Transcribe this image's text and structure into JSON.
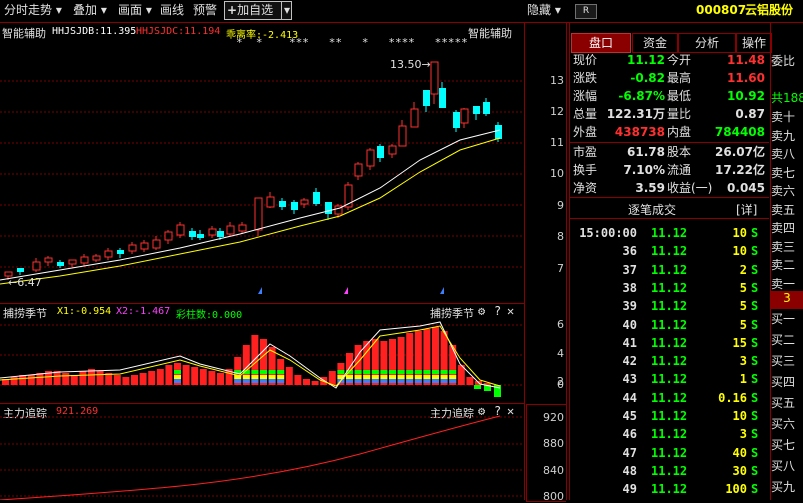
{
  "toolbar": {
    "items": [
      "分时走势",
      "叠加",
      "画面",
      "画线",
      "预警"
    ],
    "add_watch": "加自选",
    "hide": "隐藏",
    "corner_icon": "R"
  },
  "stock": {
    "code": "000807",
    "name": "云铝股份"
  },
  "main_chart": {
    "indicator_name": "智能辅助",
    "indicator_name_right": "智能辅助",
    "line1": "HHJSJDB:11.395",
    "line2": "HHJSJDC:11.194",
    "deviation": "乖离率:-2.413",
    "stars": "*  *    ***   **   *   ****   *****",
    "high_label": "13.50",
    "low_label": "6.47",
    "y_ticks": [
      "13",
      "12",
      "11",
      "10",
      "9",
      "8",
      "7"
    ]
  },
  "sub1": {
    "name": "捕捞季节",
    "x1": "X1:-0.954",
    "x2": "X2:-1.467",
    "bars": "彩柱数:0.000",
    "y_ticks": [
      "6",
      "4",
      "2",
      "0"
    ]
  },
  "sub2": {
    "name": "主力追踪",
    "value": "921.269",
    "y_ticks": [
      "920",
      "880",
      "840",
      "800"
    ]
  },
  "tabs": [
    "盘口",
    "资金",
    "分析",
    "操作"
  ],
  "quote": {
    "rows": [
      {
        "l1": "现价",
        "v1": "11.12",
        "l2": "今开",
        "v2": "11.48",
        "c1": "#00ff00",
        "c2": "#ff3030"
      },
      {
        "l1": "涨跌",
        "v1": "-0.82",
        "l2": "最高",
        "v2": "11.60",
        "c1": "#00ff00",
        "c2": "#ff3030"
      },
      {
        "l1": "涨幅",
        "v1": "-6.87%",
        "l2": "最低",
        "v2": "10.92",
        "c1": "#00ff00",
        "c2": "#00ff00"
      },
      {
        "l1": "总量",
        "v1": "122.31万",
        "l2": "量比",
        "v2": "0.87",
        "c1": "#e0e0e0",
        "c2": "#e0e0e0"
      },
      {
        "l1": "外盘",
        "v1": "438738",
        "l2": "内盘",
        "v2": "784408",
        "c1": "#ff3030",
        "c2": "#00ff00"
      },
      {
        "l1": "市盈",
        "v1": "61.78",
        "l2": "股本",
        "v2": "26.07亿",
        "c1": "#e0e0e0",
        "c2": "#e0e0e0"
      },
      {
        "l1": "换手",
        "v1": "7.10%",
        "l2": "流通",
        "v2": "17.22亿",
        "c1": "#e0e0e0",
        "c2": "#e0e0e0"
      },
      {
        "l1": "净资",
        "v1": "3.59",
        "l2": "收益(一)",
        "v2": "0.045",
        "c1": "#e0e0e0",
        "c2": "#e0e0e0"
      }
    ]
  },
  "trades": {
    "title": "逐笔成交",
    "detail": "[详]",
    "rows": [
      {
        "t": "15:00:00",
        "p": "11.12",
        "v": "10",
        "s": "S"
      },
      {
        "t": "36",
        "p": "11.12",
        "v": "10",
        "s": "S"
      },
      {
        "t": "37",
        "p": "11.12",
        "v": "2",
        "s": "S"
      },
      {
        "t": "38",
        "p": "11.12",
        "v": "5",
        "s": "S"
      },
      {
        "t": "39",
        "p": "11.12",
        "v": "5",
        "s": "S"
      },
      {
        "t": "40",
        "p": "11.12",
        "v": "5",
        "s": "S"
      },
      {
        "t": "41",
        "p": "11.12",
        "v": "15",
        "s": "S"
      },
      {
        "t": "42",
        "p": "11.12",
        "v": "3",
        "s": "S"
      },
      {
        "t": "43",
        "p": "11.12",
        "v": "1",
        "s": "S"
      },
      {
        "t": "44",
        "p": "11.12",
        "v": "0.16",
        "s": "S"
      },
      {
        "t": "45",
        "p": "11.12",
        "v": "10",
        "s": "S"
      },
      {
        "t": "46",
        "p": "11.12",
        "v": "3",
        "s": "S"
      },
      {
        "t": "47",
        "p": "11.12",
        "v": "40",
        "s": "S"
      },
      {
        "t": "48",
        "p": "11.12",
        "v": "30",
        "s": "S"
      },
      {
        "t": "49",
        "p": "11.12",
        "v": "100",
        "s": "S"
      }
    ]
  },
  "orderbook": {
    "header": "委比",
    "sells": [
      "卖十",
      "卖九",
      "卖八",
      "卖七",
      "卖六",
      "卖五",
      "卖四",
      "卖三",
      "卖二",
      "卖一"
    ],
    "gap": "3",
    "buys": [
      "买一",
      "买二",
      "买三",
      "买四",
      "买五",
      "买六",
      "买七",
      "买八",
      "买九"
    ],
    "sell_total": "共188"
  },
  "colors": {
    "up": "#ff3030",
    "down": "#00ffff",
    "grid": "#7a0000",
    "bg": "#000000",
    "yellow": "#ffff00"
  }
}
